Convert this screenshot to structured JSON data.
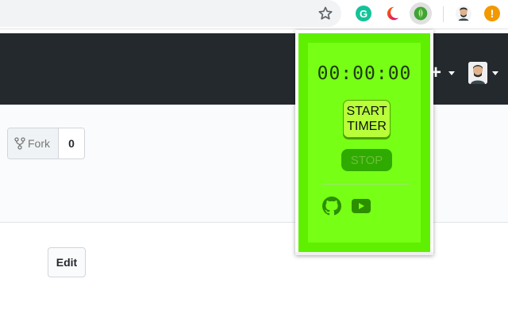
{
  "toolbar": {
    "icons": [
      "star-icon",
      "grammarly-icon",
      "crescent-moon-icon",
      "extension-leaf-icon",
      "profile-avatar-icon",
      "update-alert-icon"
    ],
    "grammarly_letter": "G",
    "alert_symbol": "!",
    "colors": {
      "grammarly": "#15c39a",
      "alert": "#f29900"
    }
  },
  "gh_header": {
    "new_button": "+",
    "icons": [
      "plus-icon",
      "caret-down-icon",
      "user-avatar-icon"
    ]
  },
  "repo": {
    "fork_label": "Fork",
    "fork_count": "0",
    "edit_label": "Edit"
  },
  "popup": {
    "timer": "00:00:00",
    "start_label_line1": "START",
    "start_label_line2": "TIMER",
    "stop_label": "STOP",
    "icons": [
      "github-icon",
      "youtube-icon"
    ],
    "colors": {
      "background": "#77ff16",
      "border": "#5ef000",
      "stop": "#2faa00",
      "icons": "#2b8f00"
    }
  }
}
